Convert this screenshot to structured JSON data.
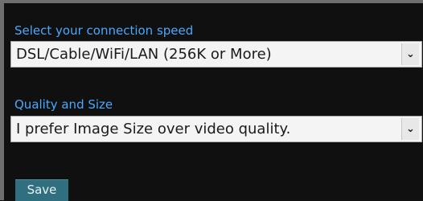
{
  "connection": {
    "label": "Select your connection speed",
    "selected": "DSL/Cable/WiFi/LAN (256K or More)",
    "arrow": "⌄"
  },
  "quality": {
    "label": "Quality and Size",
    "selected": "I prefer Image Size over video quality.",
    "arrow": "⌄"
  },
  "save_label": "Save",
  "colors": {
    "label": "#4aa8ff",
    "background": "#111111",
    "save_button": "#2f6f7f"
  }
}
